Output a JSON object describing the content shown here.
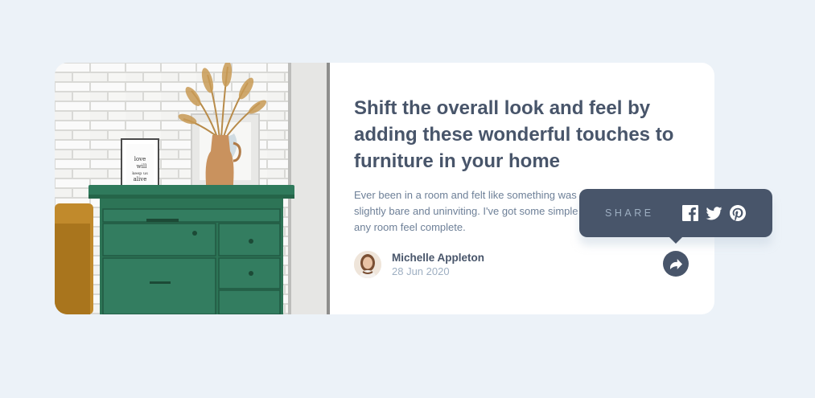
{
  "article": {
    "title": "Shift the overall look and feel by adding these wonderful touches to furniture in your home",
    "excerpt": "Ever been in a room and felt like something was missing? Perhaps it felt slightly bare and uninviting. I've got some simple tips to help you make any room feel complete."
  },
  "photo": {
    "frame_text": "love will keep us alive"
  },
  "author": {
    "name": "Michelle Appleton",
    "date": "28 Jun 2020"
  },
  "share": {
    "label": "SHARE",
    "icons": [
      "facebook-icon",
      "twitter-icon",
      "pinterest-icon"
    ]
  },
  "colors": {
    "background": "#ecf2f8",
    "heading": "#48556a",
    "body_text": "#6e8098",
    "muted": "#9eafc2",
    "tooltip": "#48556a",
    "card": "#ffffff"
  }
}
